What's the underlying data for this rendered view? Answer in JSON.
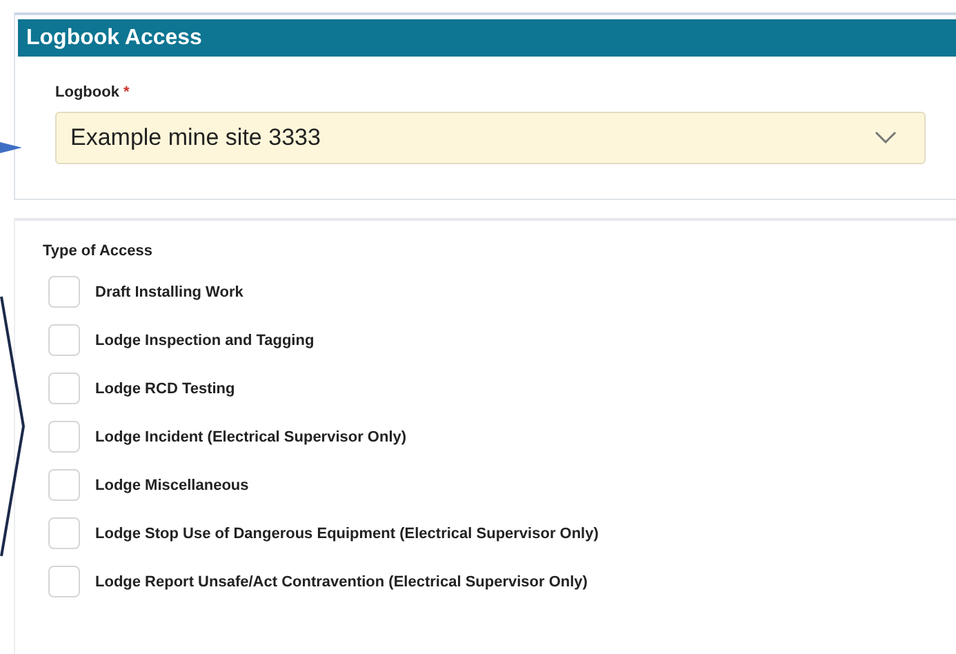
{
  "panel": {
    "title": "Logbook Access"
  },
  "logbook": {
    "label": "Logbook",
    "required_mark": "*",
    "value": "Example mine site 3333"
  },
  "access": {
    "label": "Type of Access",
    "options": [
      {
        "label": "Draft Installing Work",
        "checked": false
      },
      {
        "label": "Lodge Inspection and Tagging",
        "checked": false
      },
      {
        "label": "Lodge RCD Testing",
        "checked": false
      },
      {
        "label": "Lodge Incident (Electrical Supervisor Only)",
        "checked": false
      },
      {
        "label": "Lodge Miscellaneous",
        "checked": false
      },
      {
        "label": "Lodge Stop Use of Dangerous Equipment (Electrical Supervisor Only)",
        "checked": false
      },
      {
        "label": "Lodge Report Unsafe/Act Contravention (Electrical Supervisor Only)",
        "checked": false
      }
    ]
  }
}
